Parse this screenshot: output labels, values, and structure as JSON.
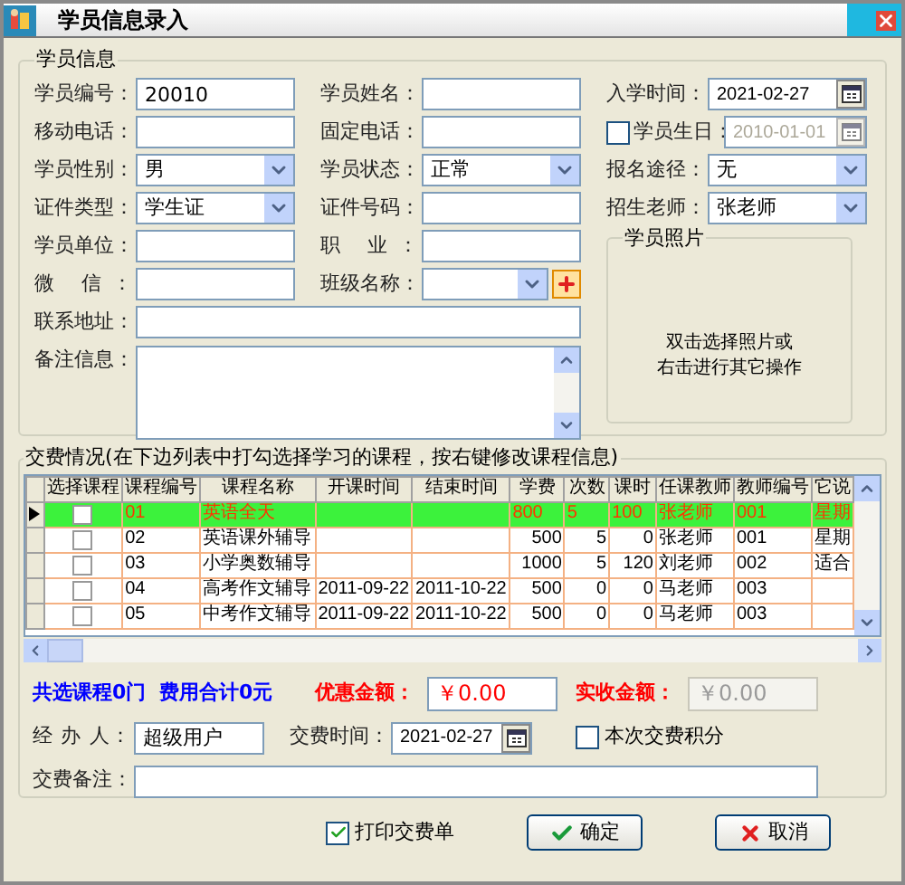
{
  "window": {
    "title": "学员信息录入"
  },
  "student_info": {
    "title": "学员信息",
    "fields": [
      {
        "label": "学员编号：",
        "kind": "text",
        "value": "20010"
      },
      {
        "label": "学员姓名：",
        "kind": "text"
      },
      {
        "label": "入学时间：",
        "kind": "date",
        "value": "2021-02-27"
      },
      {
        "label": "移动电话：",
        "kind": "text"
      },
      {
        "label": "固定电话：",
        "kind": "text"
      },
      {
        "label": "学员生日：",
        "kind": "date",
        "value": "2010-01-01",
        "checked": false
      },
      {
        "label": "学员性别：",
        "kind": "select",
        "value": "男"
      },
      {
        "label": "学员状态：",
        "kind": "select",
        "value": "正常"
      },
      {
        "label": "报名途径：",
        "kind": "select",
        "value": "无"
      },
      {
        "label": "证件类型：",
        "kind": "select",
        "value": "学生证"
      },
      {
        "label": "证件号码：",
        "kind": "text"
      },
      {
        "label": "招生老师：",
        "kind": "select",
        "value": "张老师"
      },
      {
        "label": "学员单位：",
        "kind": "text"
      },
      {
        "label": "职 业：",
        "kind": "text"
      },
      {
        "label": "微 信：",
        "kind": "text"
      },
      {
        "label": "班级名称：",
        "kind": "select_add"
      }
    ],
    "address": {
      "label": "联系地址："
    },
    "remarks": {
      "label": "备注信息："
    },
    "photo": {
      "title": "学员照片",
      "hint_lines": [
        "双击选择照片或",
        "右击进行其它操作"
      ]
    }
  },
  "fees": {
    "title": "交费情况(在下边列表中打勾选择学习的课程，按右键修改课程信息)",
    "table": {
      "columns": [
        "选择课程",
        "课程编号",
        "课程名称",
        "开课时间",
        "结束时间",
        "学费",
        "次数",
        "课时",
        "任课教师",
        "教师编号",
        "它说"
      ],
      "rows": [
        {
          "selected": true,
          "checked": false,
          "cells": [
            "",
            "01",
            "英语全天",
            null,
            null,
            "800",
            "5",
            "100",
            "张老师",
            "001",
            "星期"
          ]
        },
        {
          "selected": false,
          "checked": false,
          "cells": [
            "",
            "02",
            "英语课外辅导",
            null,
            null,
            "500",
            "5",
            "0",
            "张老师",
            "001",
            "星期"
          ]
        },
        {
          "selected": false,
          "checked": false,
          "cells": [
            "",
            "03",
            "小学奥数辅导",
            null,
            null,
            "1000",
            "5",
            "120",
            "刘老师",
            "002",
            "适合"
          ]
        },
        {
          "selected": false,
          "checked": false,
          "cells": [
            "",
            "04",
            "高考作文辅导",
            "2011-09-22",
            "2011-10-22",
            "500",
            "0",
            "0",
            "马老师",
            "003",
            null
          ]
        },
        {
          "selected": false,
          "checked": false,
          "cells": [
            "",
            "05",
            "中考作文辅导",
            "2011-09-22",
            "2011-10-22",
            "500",
            "0",
            "0",
            "马老师",
            "003",
            null
          ]
        }
      ]
    },
    "summary": {
      "course_count": "共选课程0门",
      "fee_total": "费用合计0元",
      "discount": {
        "label": "优惠金额：",
        "value": "￥0.00",
        "disabled": false
      },
      "received": {
        "label": "实收金额：",
        "value": "￥0.00",
        "disabled": true
      }
    },
    "handler": {
      "label": "经 办 人：",
      "value": "超级用户"
    },
    "pay_time": {
      "label": "交费时间：",
      "value": "2021-02-27"
    },
    "points": {
      "label": "本次交费积分",
      "checked": false
    },
    "note": {
      "label": "交费备注："
    }
  },
  "footer": {
    "print": {
      "label": "打印交费单",
      "checked": true
    },
    "buttons": [
      {
        "label": "确定",
        "kind": "ok"
      },
      {
        "label": "取消",
        "kind": "cancel"
      }
    ]
  }
}
